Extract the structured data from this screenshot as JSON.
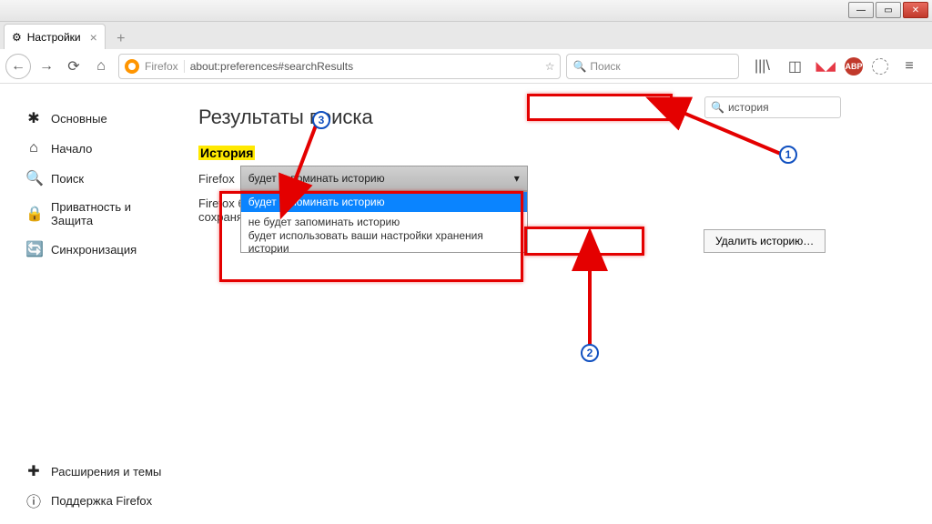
{
  "window": {
    "title": "Настройки"
  },
  "toolbar": {
    "firefox_label": "Firefox",
    "url": "about:preferences#searchResults",
    "search_placeholder": "Поиск"
  },
  "icons": {
    "library": "|||\\",
    "sidebar": "◫",
    "abp": "ABP",
    "menu": "≡"
  },
  "sidebar": {
    "items": [
      {
        "label": "Основные"
      },
      {
        "label": "Начало"
      },
      {
        "label": "Поиск"
      },
      {
        "label": "Приватность и Защита"
      },
      {
        "label": "Синхронизация"
      }
    ],
    "ext_label": "Расширения и темы",
    "support_label": "Поддержка Firefox"
  },
  "main": {
    "title": "Результаты поиска",
    "section": "История",
    "row_prefix": "Firefox",
    "select_value": "будет запоминать историю",
    "options": [
      "будет запоминать историю",
      "не будет запоминать историю",
      "будет использовать ваши настройки хранения истории"
    ],
    "desc_prefix": "Firefox б",
    "desc_suffix": "сохраня",
    "delete_label": "Удалить историю…",
    "search_value": "история"
  },
  "badges": {
    "b1": "1",
    "b2": "2",
    "b3": "3"
  }
}
